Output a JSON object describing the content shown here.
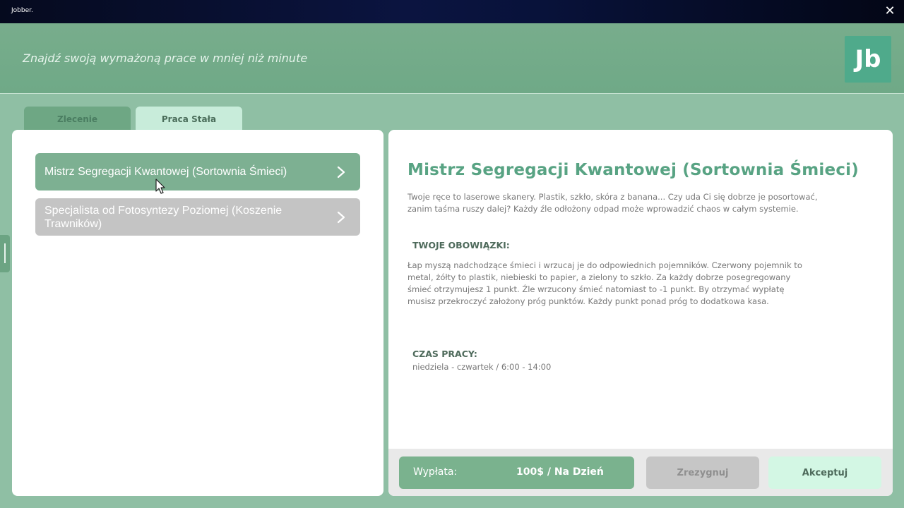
{
  "window": {
    "title": "Jobber.",
    "close_glyph": "✕"
  },
  "header": {
    "slogan": "Znajdź swoją wymażoną prace w mniej niż minute",
    "logo_text": "Jb"
  },
  "tabs": [
    {
      "label": "Zlecenie",
      "active": false
    },
    {
      "label": "Praca Stała",
      "active": true
    }
  ],
  "jobs": [
    {
      "title": "Mistrz Segregacji Kwantowej (Sortownia Śmieci)",
      "selected": true
    },
    {
      "title": "Specjalista od Fotosyntezy Poziomej (Koszenie Trawników)",
      "selected": false
    }
  ],
  "detail": {
    "title": "Mistrz Segregacji Kwantowej (Sortownia Śmieci)",
    "description": "Twoje ręce to laserowe skanery. Plastik, szkło, skóra z banana... Czy uda Ci się dobrze je posortować, zanim taśma ruszy dalej? Każdy źle odłożony odpad może wprowadzić chaos w całym systemie.",
    "duties_heading": "TWOJE OBOWIĄZKI:",
    "duties": "Łap myszą nadchodzące śmieci i wrzucaj je do odpowiednich pojemników. Czerwony pojemnik to metal, żółty to plastik, niebieski to papier, a zielony to szkło. Za każdy dobrze posegregowany śmieć otrzymujesz 1 punkt. Źle wrzucony śmieć natomiast to -1 punkt. By otrzymać wypłatę musisz przekroczyć założony próg punktów. Każdy punkt ponad próg to dodatkowa kasa.",
    "hours_heading": "CZAS PRACY:",
    "hours": "niedziela - czwartek / 6:00 - 14:00"
  },
  "footer": {
    "pay_label": "Wypłata:",
    "pay_value": "100$ / Na Dzień",
    "resign_label": "Zrezygnuj",
    "accept_label": "Akceptuj"
  },
  "colors": {
    "accent": "#58a383",
    "selected_item": "#7db092",
    "unselected_item": "#c4c4c4",
    "accept_button": "#d3f7e4"
  }
}
